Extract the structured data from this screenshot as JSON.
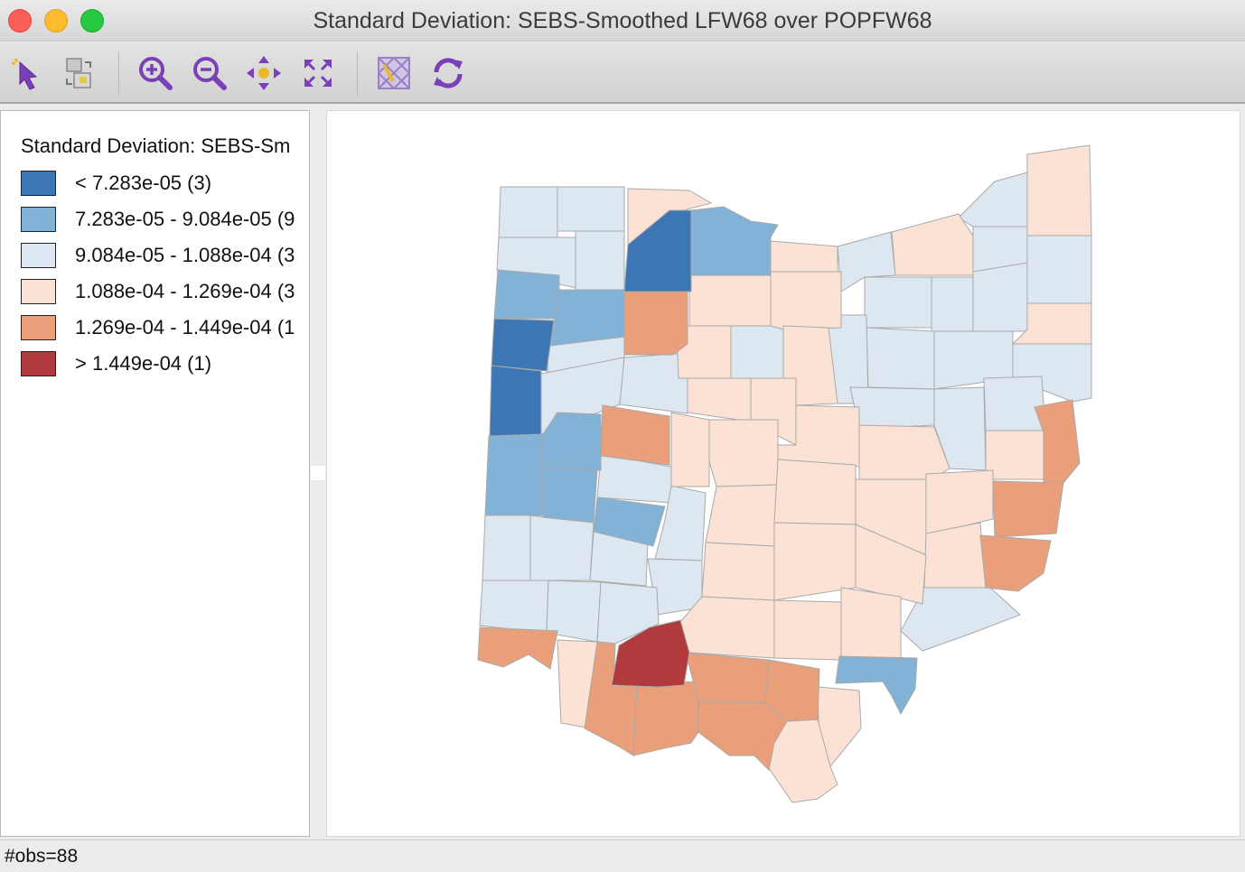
{
  "window": {
    "title": "Standard Deviation: SEBS-Smoothed LFW68 over POPFW68"
  },
  "toolbar": {
    "tools": [
      {
        "name": "select-tool-icon",
        "tooltip": ""
      },
      {
        "name": "selection-mode-icon",
        "tooltip": ""
      },
      {
        "name": "zoom-in-icon",
        "tooltip": ""
      },
      {
        "name": "zoom-out-icon",
        "tooltip": ""
      },
      {
        "name": "pan-icon",
        "tooltip": ""
      },
      {
        "name": "fit-extent-icon",
        "tooltip": ""
      },
      {
        "name": "toggle-layer-icon",
        "tooltip": ""
      },
      {
        "name": "refresh-icon",
        "tooltip": ""
      }
    ]
  },
  "legend": {
    "title": "Standard Deviation: SEBS-Sm",
    "items": [
      {
        "label": "< 7.283e-05 (3)",
        "color": "#3d76b4"
      },
      {
        "label": "7.283e-05 - 9.084e-05 (9",
        "color": "#82b2d6"
      },
      {
        "label": "9.084e-05 - 1.088e-04 (3",
        "color": "#dde7f1"
      },
      {
        "label": "1.088e-04 - 1.269e-04 (3",
        "color": "#fbe2d5"
      },
      {
        "label": "1.269e-04 - 1.449e-04 (1",
        "color": "#e9a07a"
      },
      {
        "label": "> 1.449e-04 (1)",
        "color": "#b03a3c"
      }
    ]
  },
  "status": {
    "text": "#obs=88"
  }
}
